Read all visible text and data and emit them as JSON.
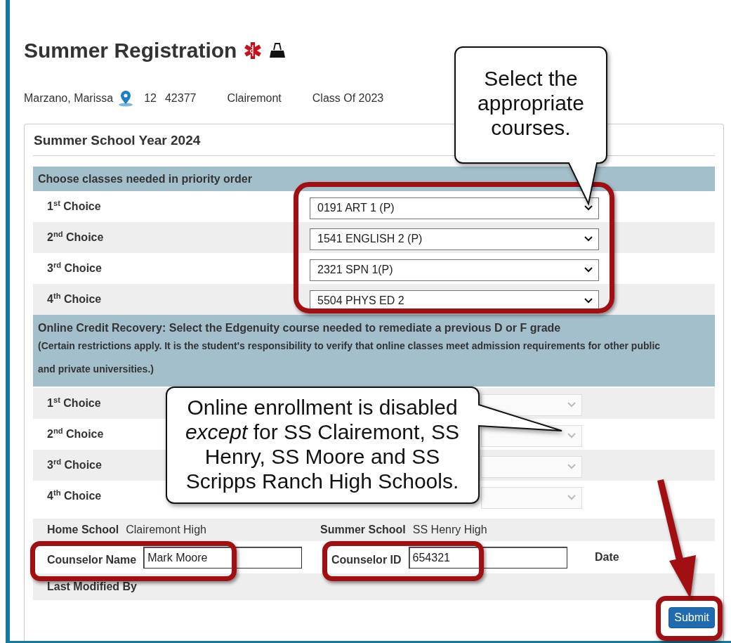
{
  "page": {
    "title": "Summer Registration"
  },
  "student": {
    "name": "Marzano, Marissa",
    "grade": "12",
    "id": "42377",
    "school": "Clairemont",
    "class_of": "Class Of 2023"
  },
  "form": {
    "title": "Summer School Year 2024",
    "priority": {
      "heading": "Choose classes needed in priority order",
      "choices": [
        {
          "label": "1$^{st}$ Choice",
          "value": "0191 ART 1 (P)",
          "disabled": false
        },
        {
          "label": "2$^{nd}$ Choice",
          "value": "1541 ENGLISH 2 (P)",
          "disabled": false
        },
        {
          "label": "3$^{rd}$ Choice",
          "value": "2321 SPN 1(P)",
          "disabled": false
        },
        {
          "label": "4$^{th}$ Choice",
          "value": "5504 PHYS ED 2",
          "disabled": false
        }
      ]
    },
    "online": {
      "heading": "Online Credit Recovery: Select the Edgenuity course needed to remediate a previous D or F grade",
      "note": "(Certain restrictions apply. It is the student's responsibility to verify that online classes meet admission requirements for other public and private universities.)",
      "choices": [
        {
          "label": "1$^{st}$ Choice",
          "disabled": true
        },
        {
          "label": "2$^{nd}$ Choice",
          "disabled": true
        },
        {
          "label": "3$^{rd}$ Choice",
          "disabled": true
        },
        {
          "label": "4$^{th}$ Choice",
          "disabled": true
        }
      ]
    },
    "home_school": {
      "label": "Home School",
      "value": "Clairemont High"
    },
    "summer_school": {
      "label": "Summer School",
      "value": "SS Henry High"
    },
    "counselor_name": {
      "label": "Counselor Name",
      "value": "Mark Moore"
    },
    "counselor_id": {
      "label": "Counselor ID",
      "value": "654321"
    },
    "date": {
      "label": "Date"
    },
    "last_modified": {
      "label": "Last Modified By"
    },
    "submit": "Submit"
  },
  "callouts": [
    {
      "text": "Select the appropriate courses."
    },
    {
      "text": "Online enrollment is disabled *except* for SS Clairemont, SS Henry, SS Moore and SS Scripps Ranch High Schools."
    }
  ]
}
